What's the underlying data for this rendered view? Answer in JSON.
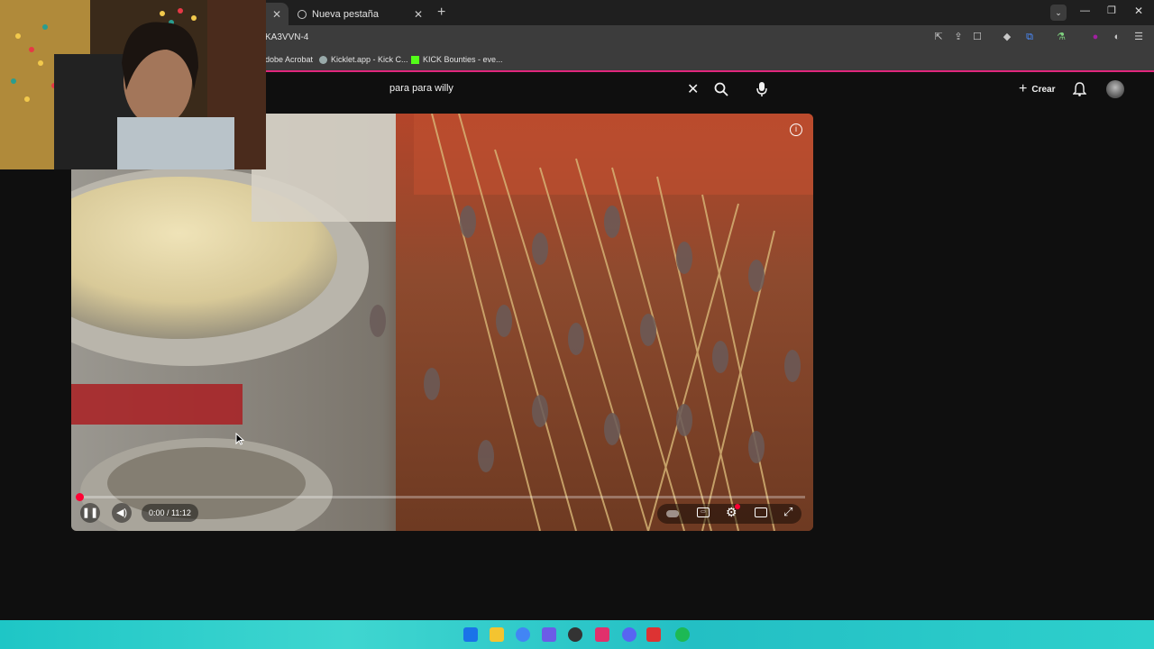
{
  "browser": {
    "tabs": [
      {
        "label": "",
        "active": true
      },
      {
        "label": "Nueva pestaña",
        "active": false
      }
    ],
    "url": "KA3VVN-4",
    "bookmarks": [
      "dobe Acrobat",
      "Kicklet.app - Kick C...",
      "KICK Bounties - eve..."
    ]
  },
  "youtube": {
    "search": {
      "value": "para para willy"
    },
    "create_label": "Crear"
  },
  "player": {
    "time": "0:00 / 11:12",
    "progress": 0.0
  },
  "colors": {
    "accent": "#ff0033",
    "pink_bar": "#e0267c",
    "taskbar": "#2cc9c8"
  }
}
